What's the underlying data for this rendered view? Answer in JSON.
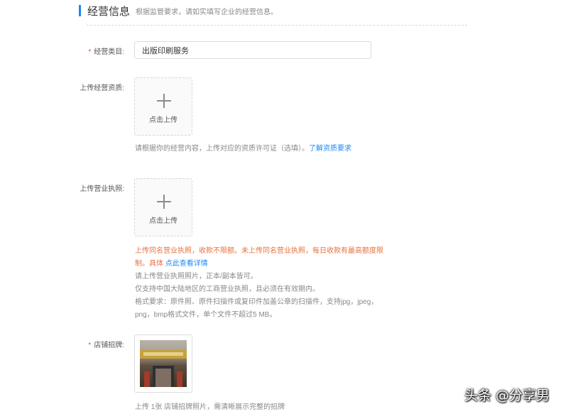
{
  "section": {
    "title": "经营信息",
    "subtitle": "根据监管要求，请如实填写企业的经营信息。"
  },
  "business_category": {
    "required_mark": "*",
    "label": "经营类目:",
    "value": "出版印刷服务"
  },
  "qualification_upload": {
    "label": "上传经营资质:",
    "button_text": "点击上传",
    "hint": "请根据你的经营内容，上传对应的资质许可证（选填）。",
    "hint_link": "了解资质要求"
  },
  "license_upload": {
    "label": "上传营业执照:",
    "button_text": "点击上传",
    "warning_line1": "上传同名营业执照，收款不限额。未上传同名营业执照，每日收款有最高额度限",
    "warning_line2": "制。具体",
    "warning_link": "点此查看详情",
    "hint_lines": [
      "请上传营业执照照片，正本/副本皆可。",
      "仅支持中国大陆地区的工商营业执照，且必须在有效期内。",
      "格式要求：原件照、原件扫描件或复印件加盖公章的扫描件，支持jpg，jpeg，",
      "png，bmp格式文件，单个文件不超过5 MB。"
    ]
  },
  "store_sign": {
    "required_mark": "*",
    "label": "店铺招牌:",
    "hint": "上传 1张 店铺招牌照片，需清晰展示完整的招牌"
  },
  "watermark": "头条 @分享男",
  "colors": {
    "accent": "#1a89f5",
    "required": "#e64b3c",
    "warning": "#e8713d",
    "link": "#1a89f5"
  }
}
